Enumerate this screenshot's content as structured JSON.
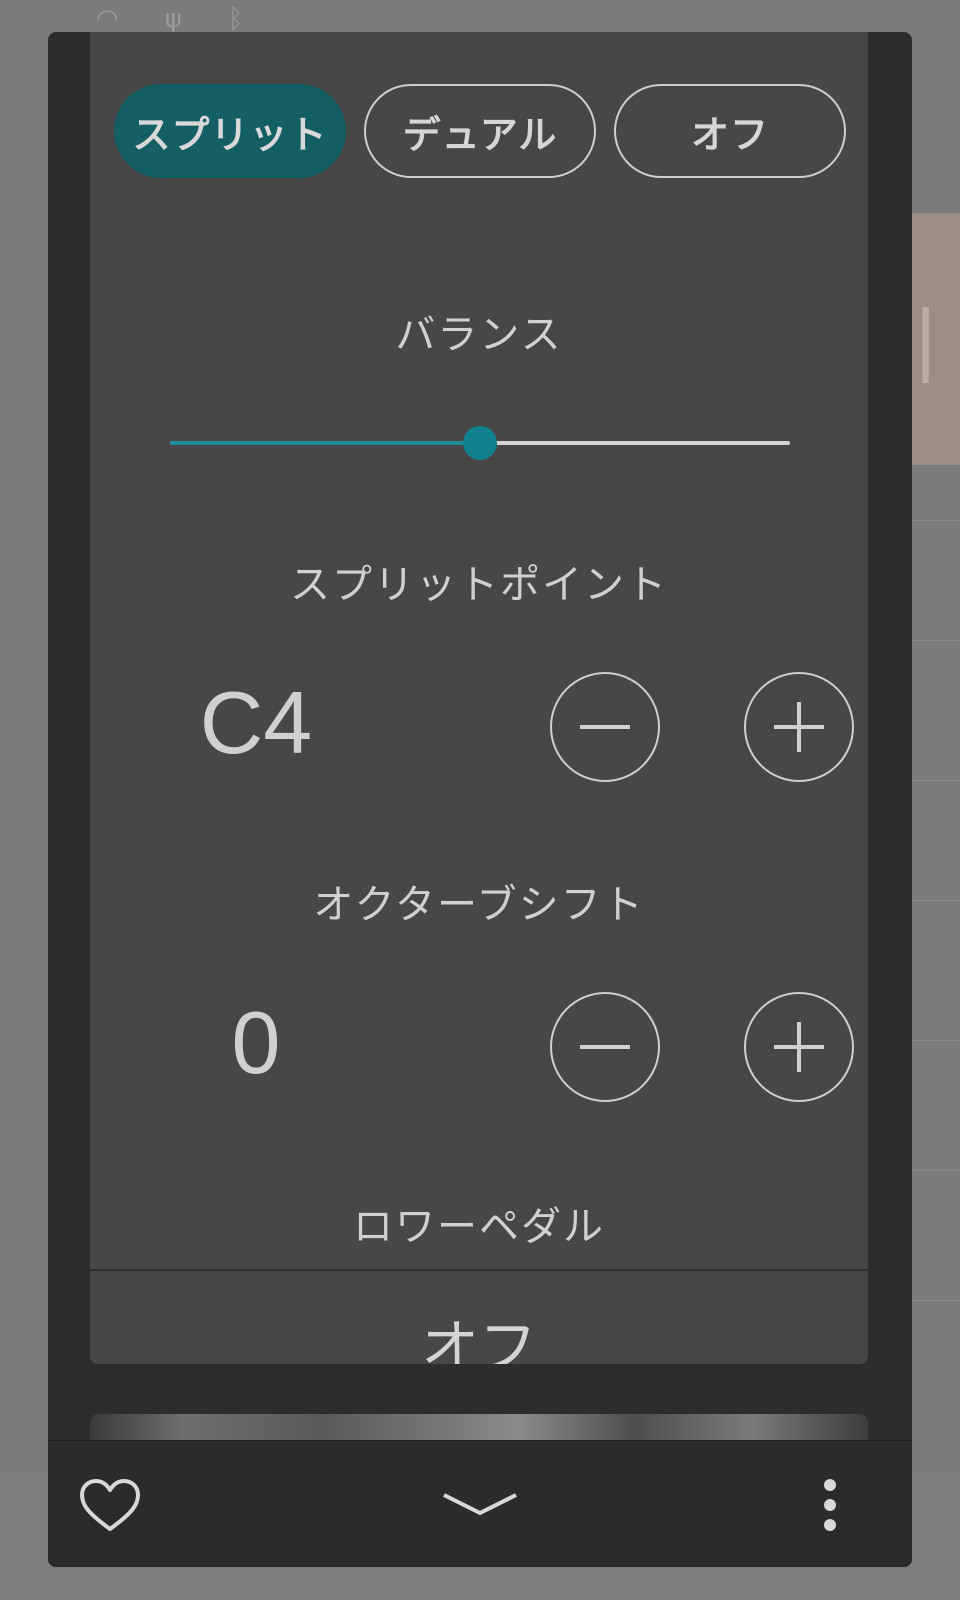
{
  "mode_selector": {
    "options": [
      {
        "label": "スプリット",
        "active": true
      },
      {
        "label": "デュアル",
        "active": false
      },
      {
        "label": "オフ",
        "active": false
      }
    ]
  },
  "balance": {
    "label": "バランス",
    "value_fraction": 0.5
  },
  "split_point": {
    "label": "スプリットポイント",
    "value": "C4"
  },
  "octave_shift": {
    "label": "オクターブシフト",
    "value": "0"
  },
  "lower_pedal": {
    "label": "ロワーペダル",
    "value": "オフ"
  },
  "colors": {
    "accent": "#145f63",
    "slider": "#12818f"
  },
  "icons": {
    "favorite": "heart-outline-icon",
    "collapse": "chevron-down-icon",
    "more": "more-vertical-icon"
  }
}
